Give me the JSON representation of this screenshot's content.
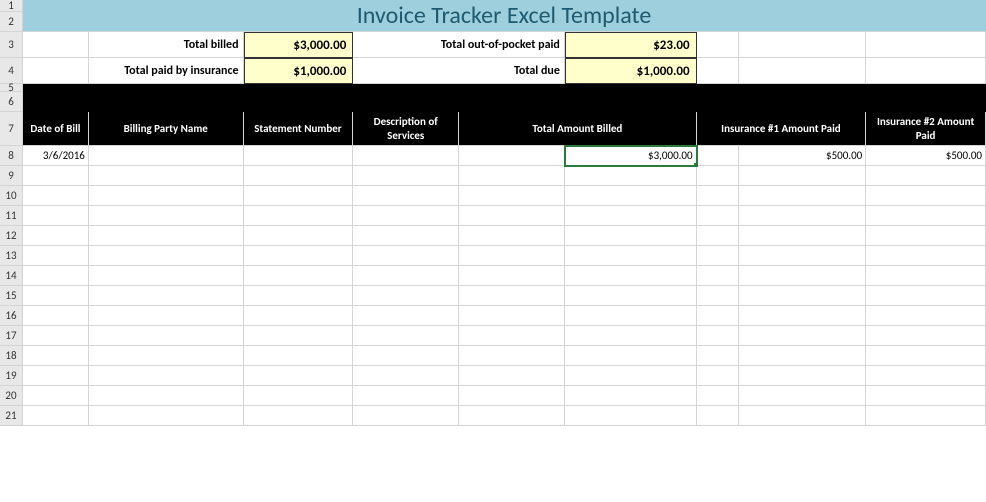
{
  "title": "Invoice Tracker Excel Template",
  "rowNumbers": [
    "1",
    "2",
    "3",
    "4",
    "5",
    "6",
    "7",
    "8",
    "9",
    "10",
    "11",
    "12",
    "13",
    "14",
    "15",
    "16",
    "17",
    "18",
    "19",
    "20",
    "21"
  ],
  "summary": {
    "totalBilledLabel": "Total billed",
    "totalBilledValue": "$3,000.00",
    "totalOutOfPocketLabel": "Total out-of-pocket paid",
    "totalOutOfPocketValue": "$23.00",
    "totalPaidByInsuranceLabel": "Total paid by insurance",
    "totalPaidByInsuranceValue": "$1,000.00",
    "totalDueLabel": "Total due",
    "totalDueValue": "$1,000.00"
  },
  "headers": {
    "dateOfBill": "Date of Bill",
    "billingPartyName": "Billing Party Name",
    "statementNumber": "Statement Number",
    "descriptionOfServices": "Description of Services",
    "totalAmountBilled": "Total Amount Billed",
    "insurance1": "Insurance #1 Amount Paid",
    "insurance2": "Insurance #2 Amount Paid"
  },
  "rows": [
    {
      "date": "3/6/2016",
      "billingParty": "",
      "statement": "",
      "description": "",
      "totalBilled": "$3,000.00",
      "ins1": "$500.00",
      "ins2": "$500.00"
    }
  ],
  "blankRowCount": 13
}
